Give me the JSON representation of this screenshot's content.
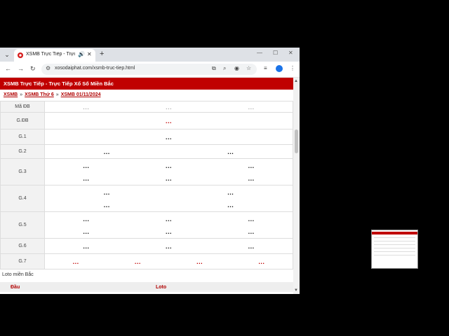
{
  "browser": {
    "tab_title": "XSMB Trực Tiếp - Trực Tiếp",
    "url": "xosodaiphat.com/xsmb-truc-tiep.html",
    "icons": [
      "chevron-down-icon",
      "favicon",
      "audio-icon",
      "close-icon",
      "plus-icon",
      "minimize-icon",
      "maximize-icon",
      "close-window-icon",
      "back-icon",
      "forward-icon",
      "reload-icon",
      "site-info-icon",
      "install-icon",
      "zoom-icon",
      "eye-off-icon",
      "star-icon",
      "extensions-icon",
      "profile-icon",
      "more-icon"
    ]
  },
  "page": {
    "header": "XSMB Trực Tiếp - Trực Tiếp Xổ Số Miền Bắc",
    "breadcrumb": [
      "XSMB",
      "XSMB Thứ 6",
      "XSMB 01/11/2024"
    ],
    "breadcrumb_sep": "»",
    "rows": [
      {
        "label": "Mã ĐB",
        "lines": [
          [
            "...",
            "...",
            "..."
          ]
        ],
        "style": "grey"
      },
      {
        "label": "G.ĐB",
        "lines": [
          [
            "..."
          ]
        ],
        "style": "red"
      },
      {
        "label": "G.1",
        "lines": [
          [
            "..."
          ]
        ],
        "style": "normal"
      },
      {
        "label": "G.2",
        "lines": [
          [
            "...",
            "..."
          ]
        ],
        "style": "normal"
      },
      {
        "label": "G.3",
        "lines": [
          [
            "...",
            "...",
            "..."
          ],
          [
            "...",
            "...",
            "..."
          ]
        ],
        "style": "normal"
      },
      {
        "label": "G.4",
        "lines": [
          [
            "...",
            "..."
          ],
          [
            "...",
            "..."
          ]
        ],
        "style": "normal"
      },
      {
        "label": "G.5",
        "lines": [
          [
            "...",
            "...",
            "..."
          ],
          [
            "...",
            "...",
            "..."
          ]
        ],
        "style": "normal"
      },
      {
        "label": "G.6",
        "lines": [
          [
            "...",
            "...",
            "..."
          ]
        ],
        "style": "normal"
      },
      {
        "label": "G.7",
        "lines": [
          [
            "...",
            "...",
            "...",
            "..."
          ]
        ],
        "style": "red"
      }
    ],
    "loto_title": "Loto miền Bắc",
    "loto_headers": [
      "Đầu",
      "Loto"
    ]
  },
  "colors": {
    "brand": "#c00000",
    "label_bg": "#f2f2f2"
  }
}
